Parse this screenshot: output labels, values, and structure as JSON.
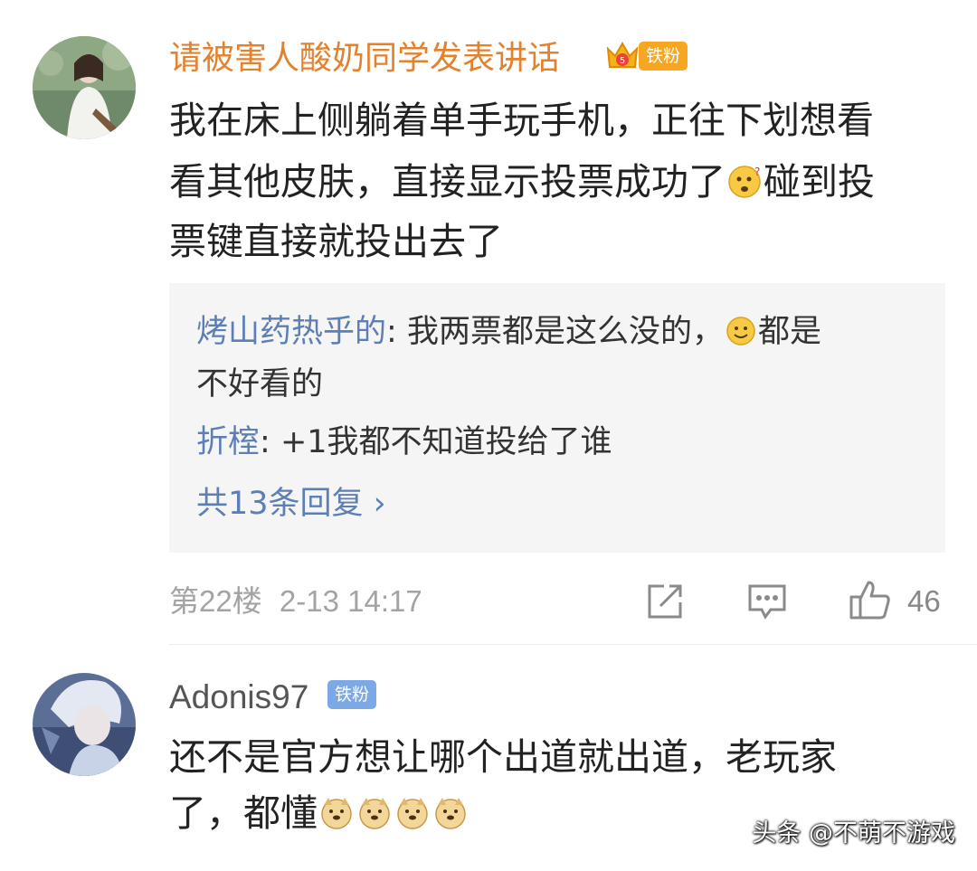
{
  "comments": [
    {
      "username": "请被害人酸奶同学发表讲话",
      "badge": "铁粉",
      "text_lines": [
        "我在床上侧躺着单手玩手机，正往下划想看",
        "看其他皮肤，直接显示投票成功了",
        "碰到投",
        "票键直接就投出去了"
      ],
      "emoji": "confused-face-emoji",
      "replies": [
        {
          "name": "烤山药热乎的",
          "sep": ": ",
          "text_a": "我两票都是这么没的，",
          "text_b": "都是",
          "text_c": "不好看的",
          "emoji": "smile-face-emoji"
        },
        {
          "name": "折榁",
          "sep": ": ",
          "text": "+1我都不知道投给了谁"
        }
      ],
      "more_replies": "共13条回复 ›",
      "floor": "第22楼",
      "time": "2-13 14:17",
      "like_count": "46"
    },
    {
      "username": "Adonis97",
      "badge": "铁粉",
      "text_line1": "还不是官方想让哪个出道就出道，老玩家",
      "text_line2": "了，都懂",
      "emoji": "doge-emoji"
    }
  ],
  "watermark": "头条 @不萌不游戏",
  "colors": {
    "username_orange": "#e4812d",
    "reply_blue": "#5d7fb6",
    "badge_orange": "#f5a623",
    "badge_blue": "#7da8e6"
  }
}
